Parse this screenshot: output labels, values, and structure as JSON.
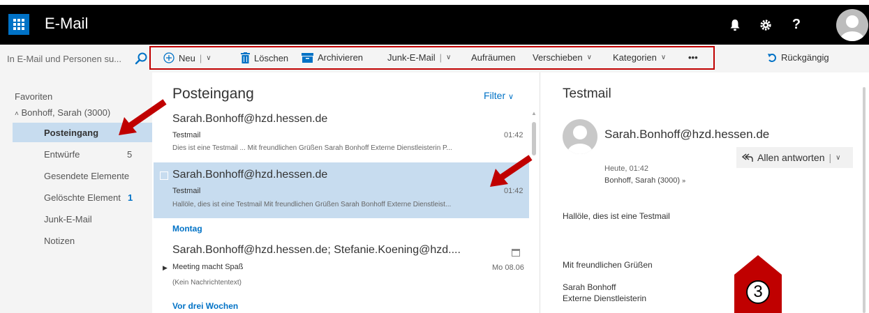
{
  "app": {
    "title": "E-Mail"
  },
  "topbar": {
    "help_label": "?"
  },
  "search": {
    "placeholder": "In E-Mail und Personen su..."
  },
  "commands": {
    "new": "Neu",
    "delete": "Löschen",
    "archive": "Archivieren",
    "junk": "Junk-E-Mail",
    "sweep": "Aufräumen",
    "move": "Verschieben",
    "categories": "Kategorien",
    "more": "•••",
    "undo": "Rückgängig"
  },
  "nav": {
    "favorites": "Favoriten",
    "account": "Bonhoff, Sarah (3000)",
    "items": [
      {
        "label": "Posteingang",
        "count": ""
      },
      {
        "label": "Entwürfe",
        "count": "5"
      },
      {
        "label": "Gesendete Elemente",
        "count": ""
      },
      {
        "label": "Gelöschte Element",
        "count": "1"
      },
      {
        "label": "Junk-E-Mail",
        "count": ""
      },
      {
        "label": "Notizen",
        "count": ""
      }
    ]
  },
  "list": {
    "title": "Posteingang",
    "filter": "Filter",
    "messages": [
      {
        "sender": "Sarah.Bonhoff@hzd.hessen.de",
        "subject": "Testmail",
        "time": "01:42",
        "preview": "Dies ist eine Testmail ... Mit freundlichen Grüßen Sarah Bonhoff Externe Dienstleisterin P..."
      },
      {
        "sender": "Sarah.Bonhoff@hzd.hessen.de",
        "subject": "Testmail",
        "time": "01:42",
        "preview": "Hallöle, dies ist eine Testmail Mit freundlichen Grüßen Sarah Bonhoff Externe Dienstleist..."
      },
      {
        "sender": "Sarah.Bonhoff@hzd.hessen.de; Stefanie.Koening@hzd....",
        "subject": "Meeting macht Spaß",
        "time": "Mo 08.06",
        "preview": "(Kein Nachrichtentext)"
      }
    ],
    "groups": [
      "Montag",
      "Vor drei Wochen"
    ]
  },
  "reading": {
    "title": "Testmail",
    "sender": "Sarah.Bonhoff@hzd.hessen.de",
    "reply_all": "Allen antworten",
    "date": "Heute, 01:42",
    "to": "Bonhoff, Sarah (3000)",
    "body": [
      "Hallöle, dies ist eine Testmail",
      "Mit freundlichen Grüßen",
      "Sarah Bonhoff",
      "Externe Dienstleisterin"
    ]
  },
  "annotation": {
    "marker_number": "3"
  },
  "colors": {
    "accent": "#0072c6",
    "highlight": "#c7dcef",
    "annotation_red": "#c00000"
  }
}
